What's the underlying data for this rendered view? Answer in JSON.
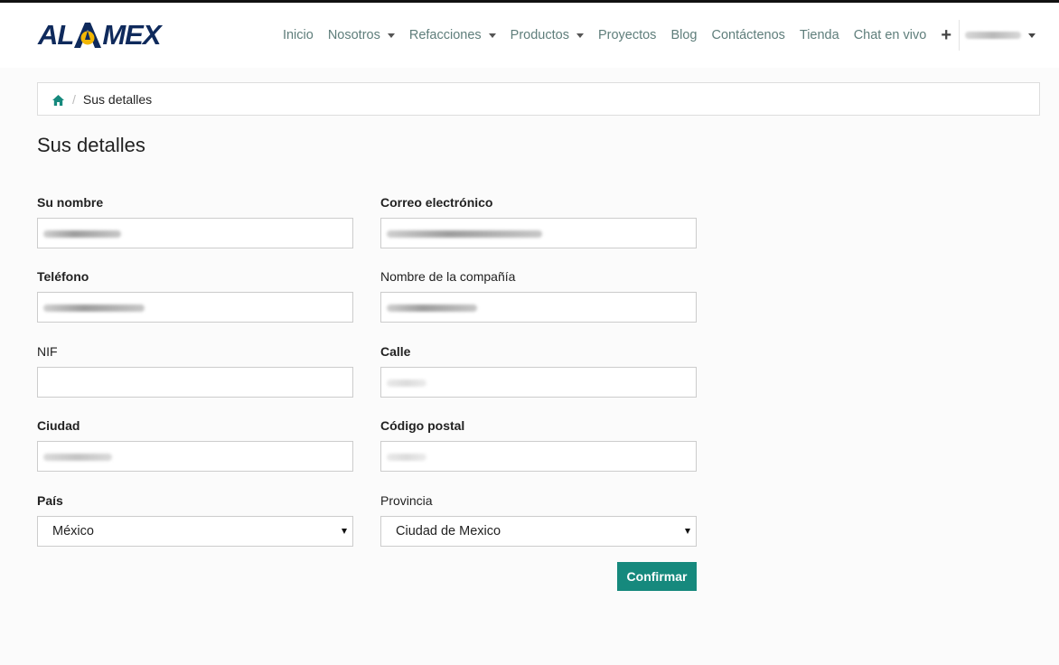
{
  "brand": {
    "logo_text_left": "AL",
    "logo_text_right": "MEX",
    "logo_colors": {
      "navy": "#0f2a5c",
      "yellow": "#f2b705"
    }
  },
  "nav": {
    "items": [
      {
        "label": "Inicio",
        "dropdown": false
      },
      {
        "label": "Nosotros",
        "dropdown": true
      },
      {
        "label": "Refacciones",
        "dropdown": true
      },
      {
        "label": "Productos",
        "dropdown": true
      },
      {
        "label": "Proyectos",
        "dropdown": false
      },
      {
        "label": "Blog",
        "dropdown": false
      },
      {
        "label": "Contáctenos",
        "dropdown": false
      },
      {
        "label": "Tienda",
        "dropdown": false
      },
      {
        "label": "Chat en vivo",
        "dropdown": false
      }
    ],
    "plus_icon": "plus-icon",
    "user_menu": {
      "name_redacted": true
    }
  },
  "breadcrumb": {
    "home_icon": "home-icon",
    "separator": "/",
    "current": "Sus detalles"
  },
  "page_title": "Sus detalles",
  "form": {
    "name": {
      "label": "Su nombre",
      "required": true,
      "value_redacted": true
    },
    "email": {
      "label": "Correo electrónico",
      "required": true,
      "value_redacted": true
    },
    "phone": {
      "label": "Teléfono",
      "required": true,
      "value_redacted": true
    },
    "company": {
      "label": "Nombre de la compañía",
      "required": false,
      "value_redacted": true
    },
    "nif": {
      "label": "NIF",
      "required": false,
      "value": ""
    },
    "street": {
      "label": "Calle",
      "required": true,
      "value_redacted": true
    },
    "city": {
      "label": "Ciudad",
      "required": true,
      "value_redacted": true
    },
    "zip": {
      "label": "Código postal",
      "required": true,
      "value_redacted": true
    },
    "country": {
      "label": "País",
      "required": true,
      "selected": "México"
    },
    "state": {
      "label": "Provincia",
      "required": false,
      "selected": "Ciudad de Mexico"
    },
    "submit_label": "Confirmar"
  },
  "colors": {
    "accent": "#16897d",
    "nav_text": "#5f7e7b",
    "border": "#cccccc"
  }
}
